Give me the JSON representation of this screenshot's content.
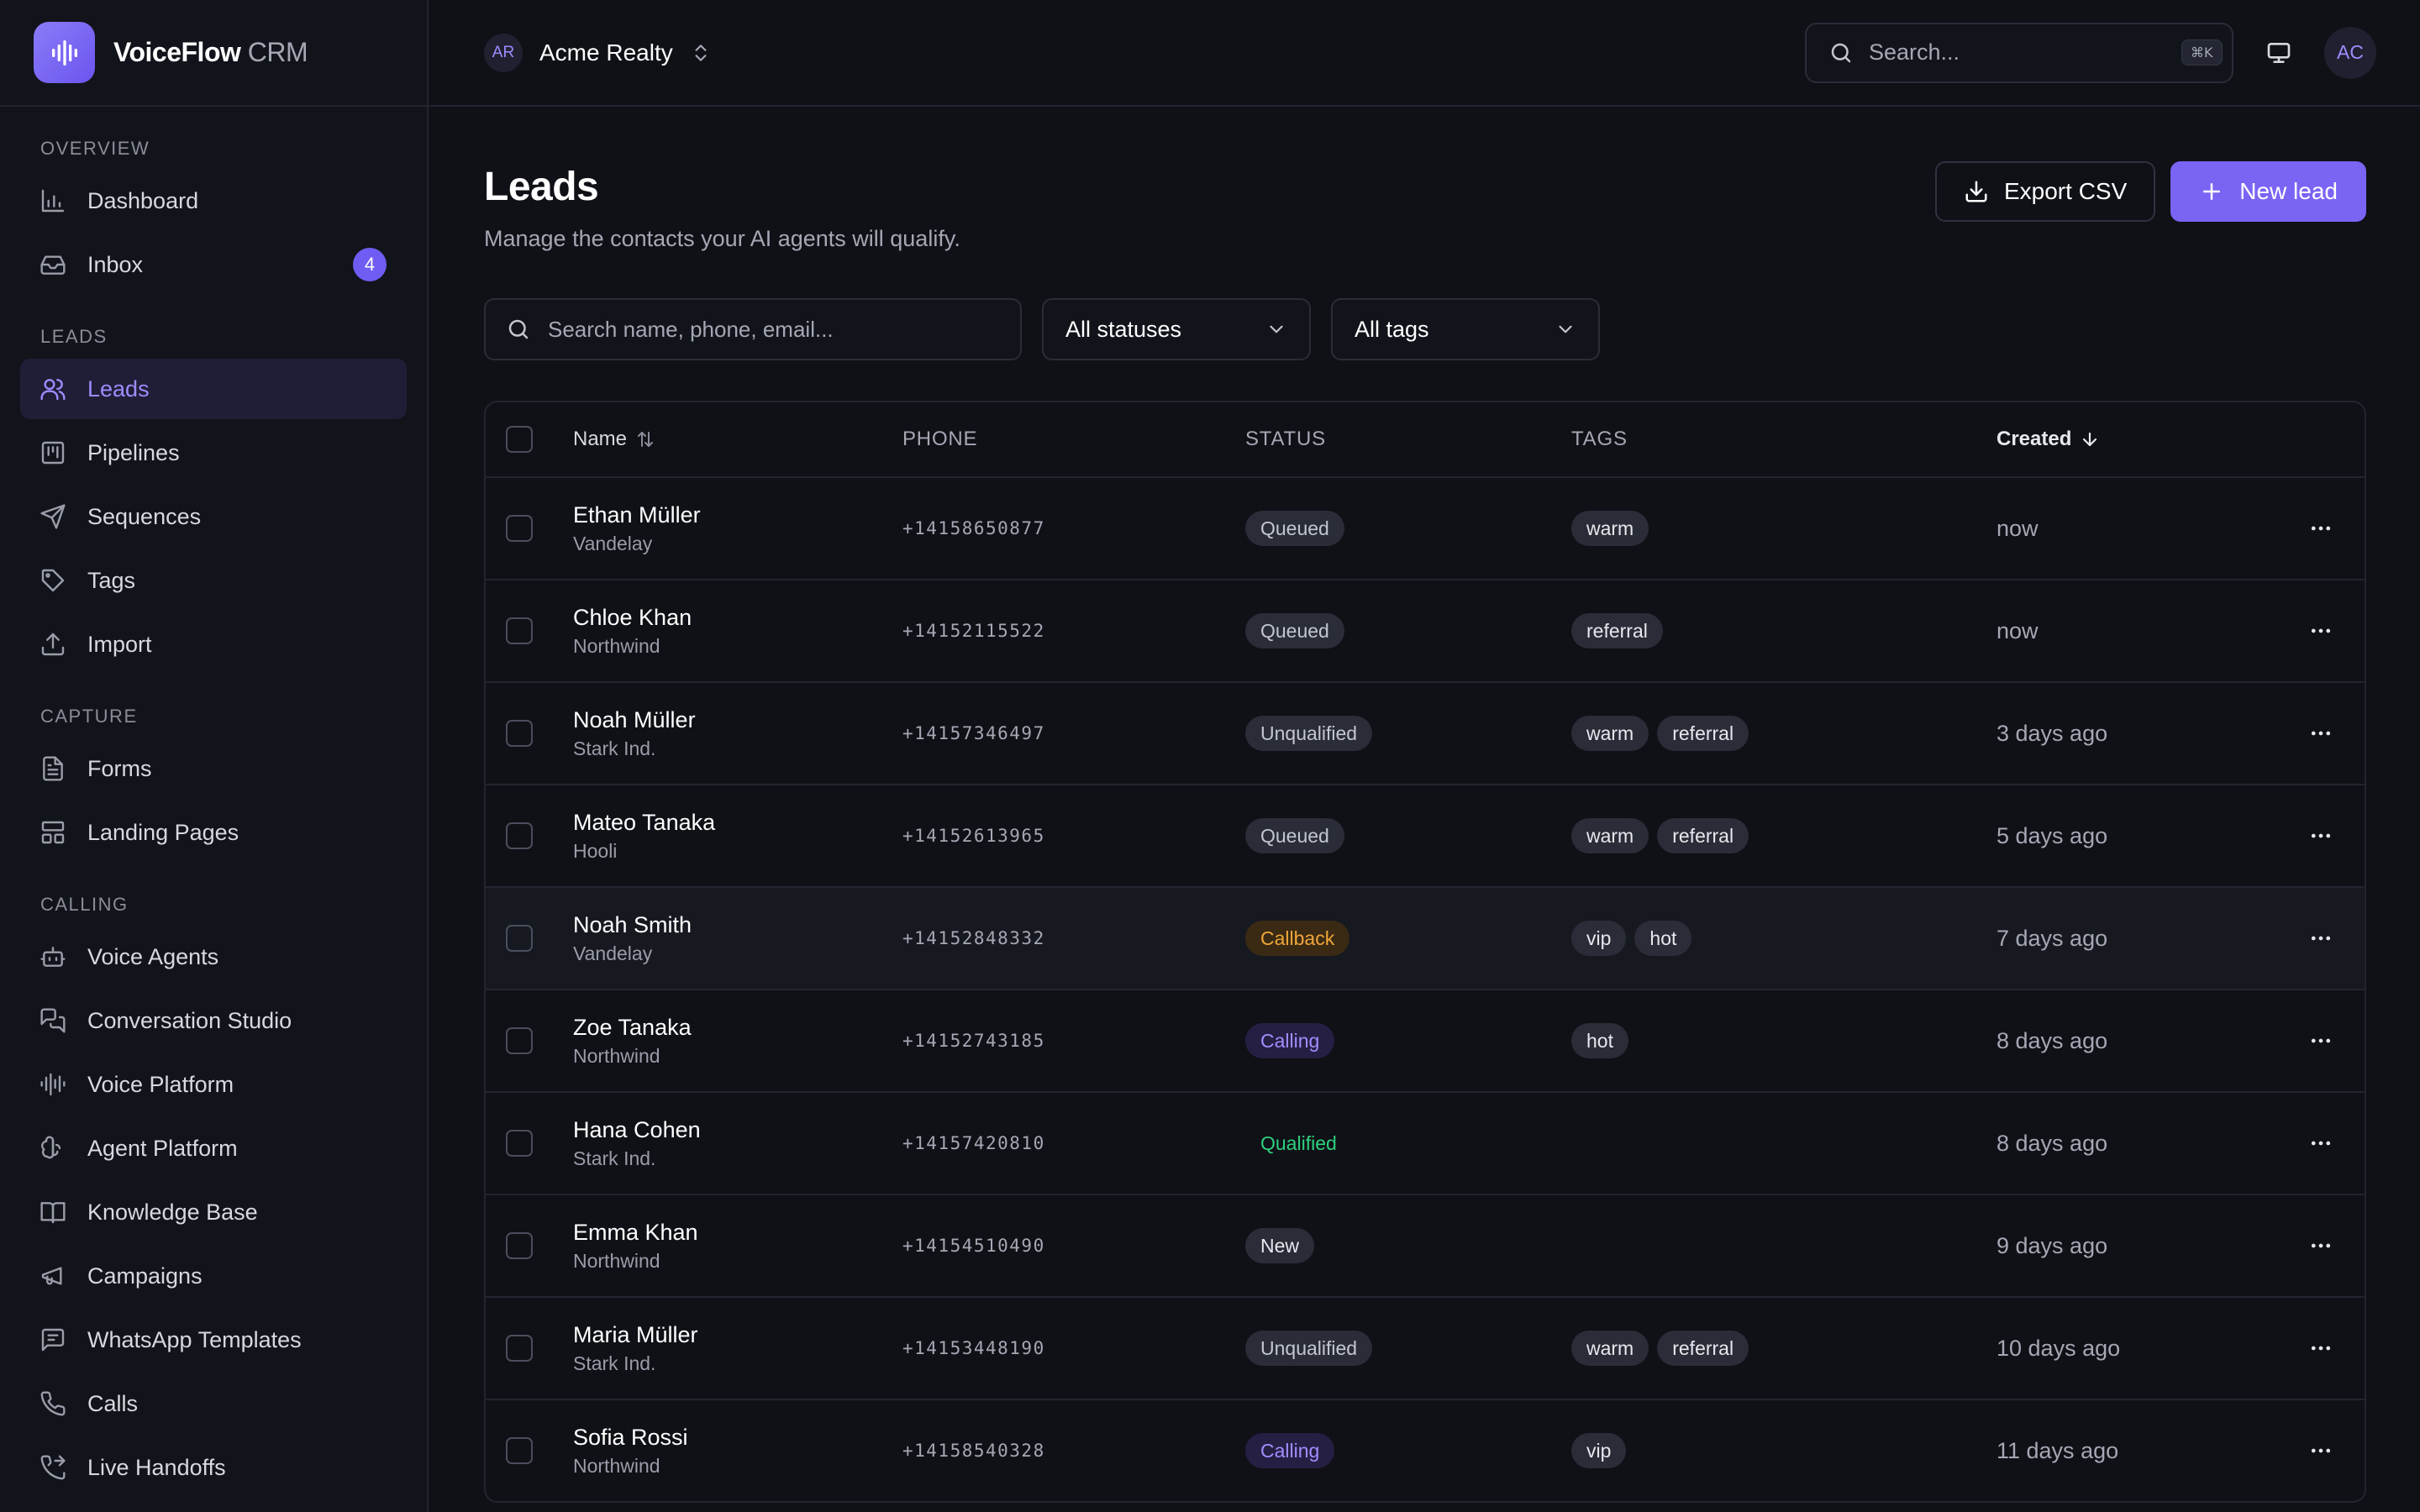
{
  "app": {
    "name": "VoiceFlow",
    "name_suffix": "CRM"
  },
  "workspace": {
    "initials": "AR",
    "name": "Acme Realty"
  },
  "topbar": {
    "search_placeholder": "Search...",
    "search_shortcut": "⌘K",
    "user_initials": "AC"
  },
  "sidebar": {
    "sections": [
      {
        "label": "OVERVIEW",
        "items": [
          {
            "label": "Dashboard",
            "icon": "bar-chart-icon"
          },
          {
            "label": "Inbox",
            "icon": "inbox-icon",
            "badge": "4"
          }
        ]
      },
      {
        "label": "LEADS",
        "items": [
          {
            "label": "Leads",
            "icon": "users-icon",
            "active": true
          },
          {
            "label": "Pipelines",
            "icon": "kanban-icon"
          },
          {
            "label": "Sequences",
            "icon": "send-icon"
          },
          {
            "label": "Tags",
            "icon": "tags-icon"
          },
          {
            "label": "Import",
            "icon": "upload-icon"
          }
        ]
      },
      {
        "label": "CAPTURE",
        "items": [
          {
            "label": "Forms",
            "icon": "form-icon"
          },
          {
            "label": "Landing Pages",
            "icon": "layout-icon"
          }
        ]
      },
      {
        "label": "CALLING",
        "items": [
          {
            "label": "Voice Agents",
            "icon": "bot-icon"
          },
          {
            "label": "Conversation Studio",
            "icon": "messages-icon"
          },
          {
            "label": "Voice Platform",
            "icon": "audio-lines-icon"
          },
          {
            "label": "Agent Platform",
            "icon": "brain-icon"
          },
          {
            "label": "Knowledge Base",
            "icon": "book-icon"
          },
          {
            "label": "Campaigns",
            "icon": "megaphone-icon"
          },
          {
            "label": "WhatsApp Templates",
            "icon": "message-square-icon"
          },
          {
            "label": "Calls",
            "icon": "phone-icon"
          },
          {
            "label": "Live Handoffs",
            "icon": "phone-forward-icon"
          }
        ]
      }
    ]
  },
  "page": {
    "title": "Leads",
    "subtitle": "Manage the contacts your AI agents will qualify.",
    "export_label": "Export CSV",
    "new_label": "New lead"
  },
  "filters": {
    "search_placeholder": "Search name, phone, email...",
    "status_value": "All statuses",
    "tags_value": "All tags"
  },
  "table": {
    "columns": {
      "name": "Name",
      "phone": "PHONE",
      "status": "STATUS",
      "tags": "TAGS",
      "created": "Created"
    },
    "rows": [
      {
        "name": "Ethan Müller",
        "company": "Vandelay",
        "phone": "+14158650877",
        "status": "Queued",
        "status_kind": "queued",
        "tags": [
          "warm"
        ],
        "created": "now"
      },
      {
        "name": "Chloe Khan",
        "company": "Northwind",
        "phone": "+14152115522",
        "status": "Queued",
        "status_kind": "queued",
        "tags": [
          "referral"
        ],
        "created": "now"
      },
      {
        "name": "Noah Müller",
        "company": "Stark Ind.",
        "phone": "+14157346497",
        "status": "Unqualified",
        "status_kind": "unqualified",
        "tags": [
          "warm",
          "referral"
        ],
        "created": "3 days ago"
      },
      {
        "name": "Mateo Tanaka",
        "company": "Hooli",
        "phone": "+14152613965",
        "status": "Queued",
        "status_kind": "queued",
        "tags": [
          "warm",
          "referral"
        ],
        "created": "5 days ago"
      },
      {
        "name": "Noah Smith",
        "company": "Vandelay",
        "phone": "+14152848332",
        "status": "Callback",
        "status_kind": "callback",
        "tags": [
          "vip",
          "hot"
        ],
        "created": "7 days ago",
        "highlight": true
      },
      {
        "name": "Zoe Tanaka",
        "company": "Northwind",
        "phone": "+14152743185",
        "status": "Calling",
        "status_kind": "calling",
        "tags": [
          "hot"
        ],
        "created": "8 days ago"
      },
      {
        "name": "Hana Cohen",
        "company": "Stark Ind.",
        "phone": "+14157420810",
        "status": "Qualified",
        "status_kind": "qualified",
        "tags": [],
        "created": "8 days ago"
      },
      {
        "name": "Emma Khan",
        "company": "Northwind",
        "phone": "+14154510490",
        "status": "New",
        "status_kind": "new",
        "tags": [],
        "created": "9 days ago"
      },
      {
        "name": "Maria Müller",
        "company": "Stark Ind.",
        "phone": "+14153448190",
        "status": "Unqualified",
        "status_kind": "unqualified",
        "tags": [
          "warm",
          "referral"
        ],
        "created": "10 days ago"
      },
      {
        "name": "Sofia Rossi",
        "company": "Northwind",
        "phone": "+14158540328",
        "status": "Calling",
        "status_kind": "calling",
        "tags": [
          "vip"
        ],
        "created": "11 days ago"
      }
    ]
  },
  "colors": {
    "accent": "#7a64f4",
    "background": "#0f1117",
    "sidebar_bg": "#12141b",
    "status_callback": "#f0a63a",
    "status_calling": "#a38dff",
    "status_qualified": "#2fd07d"
  }
}
